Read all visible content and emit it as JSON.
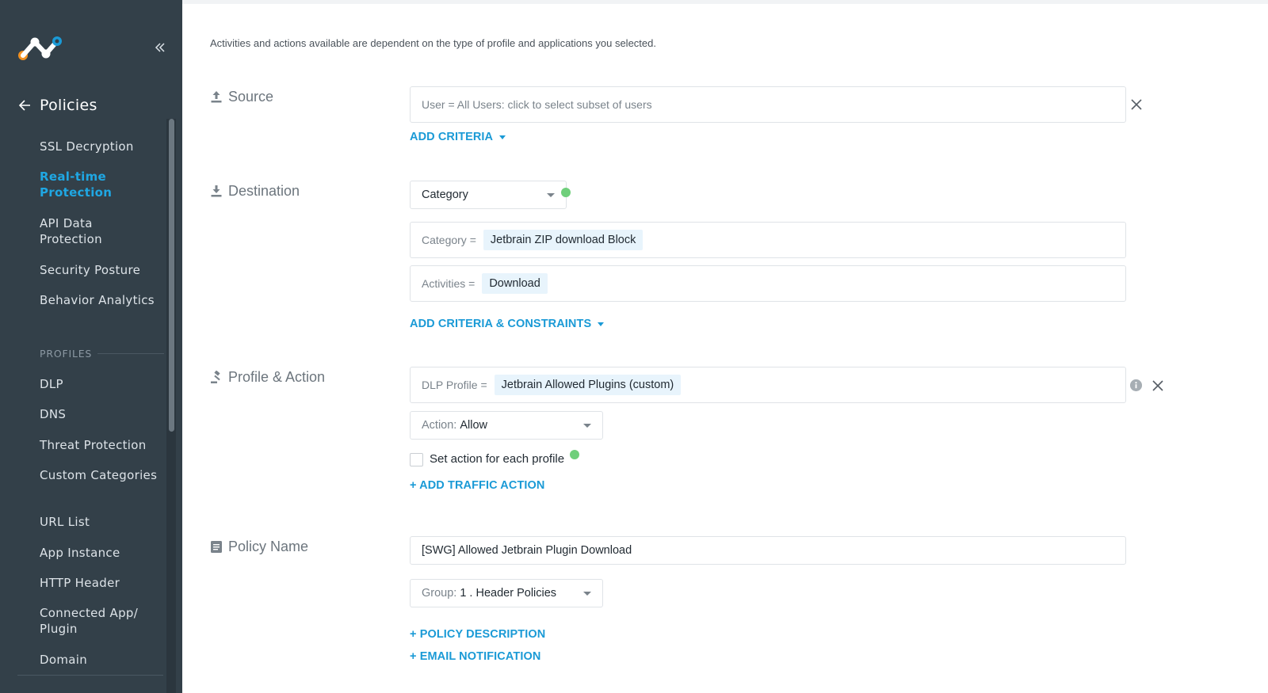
{
  "sidebar": {
    "title": "Policies",
    "items": [
      {
        "label": "SSL Decryption"
      },
      {
        "label": "Real-time Protection"
      },
      {
        "label": "API Data Protection"
      },
      {
        "label": "Security Posture"
      },
      {
        "label": "Behavior Analytics"
      }
    ],
    "section_label": "PROFILES",
    "profile_items": [
      {
        "label": "DLP"
      },
      {
        "label": "DNS"
      },
      {
        "label": "Threat Protection"
      },
      {
        "label": "Custom Categories"
      },
      {
        "label": "URL List"
      },
      {
        "label": "App Instance"
      },
      {
        "label": "HTTP Header"
      },
      {
        "label": "Connected App/ Plugin"
      },
      {
        "label": "Domain"
      }
    ],
    "active_item": "Real-time Protection"
  },
  "main": {
    "hint": "Activities and actions available are dependent on the type of profile and applications you selected.",
    "source": {
      "label": "Source",
      "field_text": "User = All Users: click to select subset of users",
      "add_link": "ADD CRITERIA"
    },
    "destination": {
      "label": "Destination",
      "select_value": "Category",
      "category_label": "Category =",
      "category_chip": "Jetbrain ZIP download Block",
      "activities_label": "Activities =",
      "activities_chip": "Download",
      "add_link": "ADD CRITERIA & CONSTRAINTS"
    },
    "profile_action": {
      "label": "Profile & Action",
      "dlp_label": "DLP Profile =",
      "dlp_chip": "Jetbrain Allowed Plugins (custom)",
      "action_label": "Action:",
      "action_value": "Allow",
      "checkbox_label": "Set action for each profile",
      "add_link": "+ ADD TRAFFIC ACTION"
    },
    "policy_name": {
      "label": "Policy Name",
      "value": "[SWG] Allowed Jetbrain Plugin Download",
      "group_label": "Group:",
      "group_value": "1 . Header Policies",
      "description_link": "+ POLICY DESCRIPTION",
      "email_link": "+ EMAIL NOTIFICATION"
    }
  },
  "colors": {
    "sidebar_bg": "#334049",
    "accent": "#1a9ad6",
    "status_dot": "#6fcf7b",
    "chip_bg": "#e8f4fc"
  },
  "icons": [
    "logo-icon",
    "collapse-icon",
    "back-arrow-icon",
    "upload-icon",
    "download-icon",
    "gavel-icon",
    "document-icon",
    "close-icon",
    "info-icon"
  ]
}
